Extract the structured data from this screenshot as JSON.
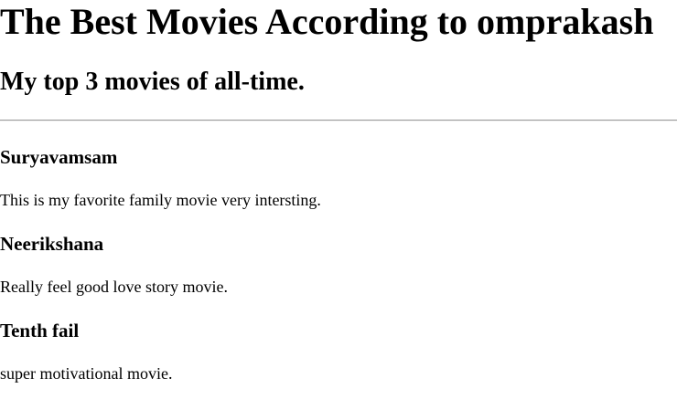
{
  "page": {
    "title": "The Best Movies According to omprakash",
    "subtitle": "My top 3 movies of all-time."
  },
  "movies": [
    {
      "name": "Suryavamsam",
      "description": "This is my favorite family movie very intersting."
    },
    {
      "name": "Neerikshana",
      "description": "Really feel good love story movie."
    },
    {
      "name": "Tenth fail",
      "description": "super motivational movie."
    }
  ]
}
